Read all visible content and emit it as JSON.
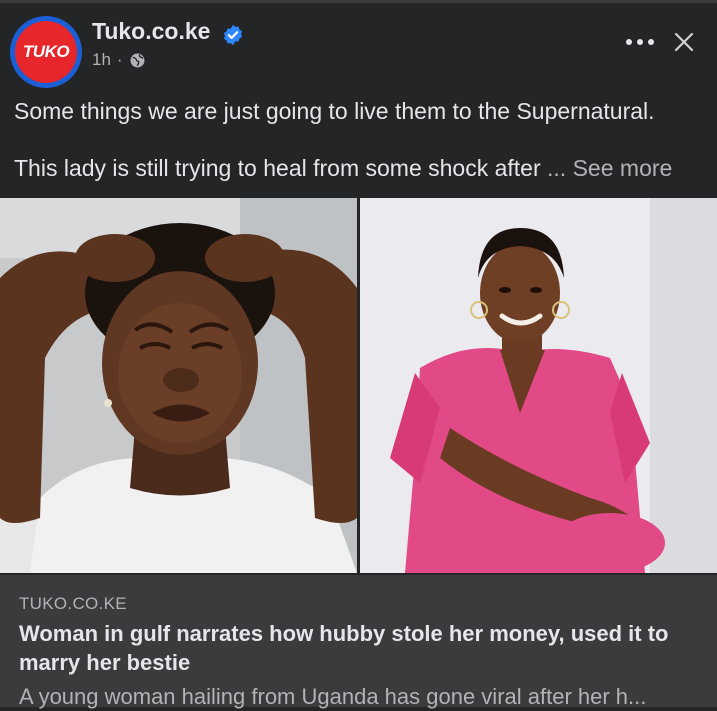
{
  "post": {
    "page_name": "Tuko.co.ke",
    "logo_text": "TUKO",
    "time": "1h",
    "separator": "·",
    "text_line1": "Some things we are just going to live them to the Supernatural.",
    "text_line2": "This lady is still trying to heal from some shock after",
    "ellipsis": "...",
    "see_more": "See more"
  },
  "link_preview": {
    "domain": "TUKO.CO.KE",
    "title": "Woman in gulf narrates how hubby stole her money, used it to marry her bestie",
    "description": "A young woman hailing from Uganda has gone viral after her h..."
  },
  "colors": {
    "background": "#242526",
    "link_box": "#3a3b3c",
    "verified": "#2d88ff",
    "logo_red": "#e6262a",
    "logo_ring": "#1b5fd6"
  },
  "icons": {
    "verified": "verified-badge-icon",
    "audience": "globe-icon",
    "more": "more-options-icon",
    "close": "close-icon"
  }
}
